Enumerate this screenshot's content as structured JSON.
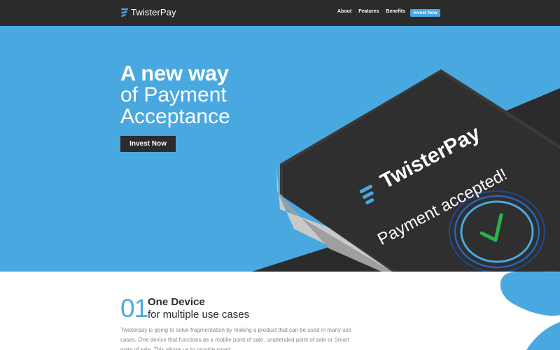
{
  "nav": {
    "brand": "TwisterPay",
    "links": [
      "About",
      "Features",
      "Benefits"
    ],
    "cta": "Invest Now"
  },
  "hero": {
    "title_bold": "A new way",
    "title_line2": "of Payment",
    "title_line3": "Acceptance",
    "cta": "Invest Now",
    "device_brand": "TwisterPay",
    "device_message": "Payment accepted!"
  },
  "feature": {
    "number": "01",
    "title": "One Device",
    "subtitle": "for multiple use cases",
    "description": "Twisterpay is going to solve fragmentation by making a product that can be used in many use cases. One device that functions as a mobile point of sale, unattended point of sale or Smart point of sale. This allows us to provide smart"
  },
  "colors": {
    "accent": "#4aa8e0",
    "dark": "#2b2b2b",
    "success": "#2bb34a"
  }
}
